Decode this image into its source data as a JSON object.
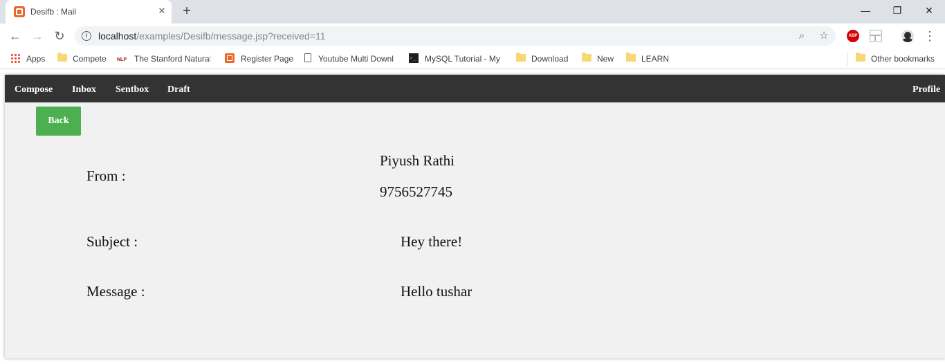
{
  "browser": {
    "tab_title": "Desifb : Mail",
    "tab_close": "✕",
    "new_tab": "+",
    "window": {
      "minimize": "—",
      "restore": "❐",
      "close": "✕"
    },
    "url_host": "localhost",
    "url_path": "/examples/Desifb/message.jsp?received=11",
    "abp_label": "ABP",
    "bookmarks": [
      {
        "label": "Apps",
        "icon": "apps-grid-icon"
      },
      {
        "label": "Compete",
        "icon": "folder-icon"
      },
      {
        "label": "The Stanford Natural",
        "icon": "nlp-icon"
      },
      {
        "label": "Register Page",
        "icon": "xampp-icon"
      },
      {
        "label": "Youtube Multi Downl",
        "icon": "page-icon"
      },
      {
        "label": "MySQL Tutorial - My",
        "icon": "terminal-icon"
      },
      {
        "label": "Download",
        "icon": "folder-icon"
      },
      {
        "label": "New",
        "icon": "folder-icon"
      },
      {
        "label": "LEARN",
        "icon": "folder-icon"
      }
    ],
    "other_bookmarks": "Other bookmarks",
    "nlp_icon_text": "NLP"
  },
  "app": {
    "nav": {
      "compose": "Compose",
      "inbox": "Inbox",
      "sentbox": "Sentbox",
      "draft": "Draft",
      "profile": "Profile"
    },
    "back_label": "Back",
    "message": {
      "from_label": "From :",
      "from_name": "Piyush Rathi",
      "from_phone": "9756527745",
      "subject_label": "Subject :",
      "subject_value": "Hey there!",
      "message_label": "Message :",
      "message_value": "Hello tushar"
    }
  }
}
